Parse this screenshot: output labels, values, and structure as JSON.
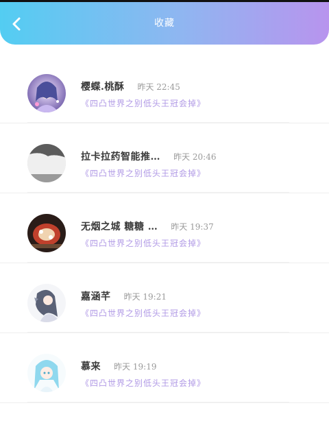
{
  "header": {
    "title": "收藏",
    "colors": {
      "gradient_start": "#53cdf2",
      "gradient_end": "#b894ee"
    },
    "back_icon": "chevron-left-icon"
  },
  "items": [
    {
      "name": "樱蝶.桃酥",
      "time": "昨天 22:45",
      "message": "《四凸世界之别低头王冠会掉》"
    },
    {
      "name": "拉卡拉药智能推…",
      "time": "昨天 20:46",
      "message": "《四凸世界之别低头王冠会掉》"
    },
    {
      "name": "无烟之城 糖糖 …",
      "time": "昨天 19:37",
      "message": "《四凸世界之别低头王冠会掉》"
    },
    {
      "name": "嘉涵芊",
      "time": "昨天 19:21",
      "message": "《四凸世界之别低头王冠会掉》"
    },
    {
      "name": "慕来",
      "time": "昨天 19:19",
      "message": "《四凸世界之别低头王冠会掉》"
    }
  ]
}
